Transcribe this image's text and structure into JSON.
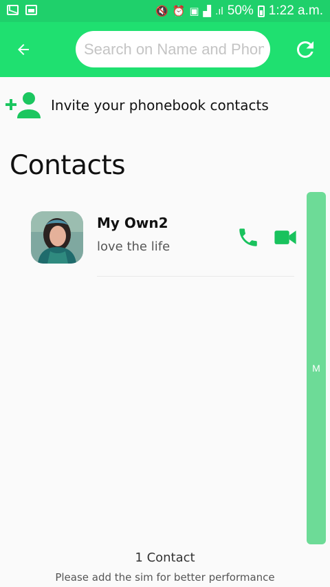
{
  "status_bar": {
    "battery": "50%",
    "time": "1:22 a.m."
  },
  "app_bar": {
    "back_icon": "arrow-left-icon",
    "refresh_icon": "refresh-icon",
    "search_placeholder": "Search on Name and Phone",
    "search_value": ""
  },
  "invite": {
    "icon": "add-person-icon",
    "label": "Invite your phonebook contacts"
  },
  "section_title": "Contacts",
  "contacts": [
    {
      "name": "My Own2",
      "status": "love the life",
      "call_icon": "phone-icon",
      "video_icon": "video-camera-icon"
    }
  ],
  "index_bar": {
    "letter": "M"
  },
  "footer": {
    "count": "1 Contact",
    "hint": "Please add the sim for better performance"
  },
  "colors": {
    "status_bar": "#1fd06b",
    "app_bar": "#1fe070",
    "accent": "#19c25d",
    "index_bar": "#6ddb97"
  }
}
